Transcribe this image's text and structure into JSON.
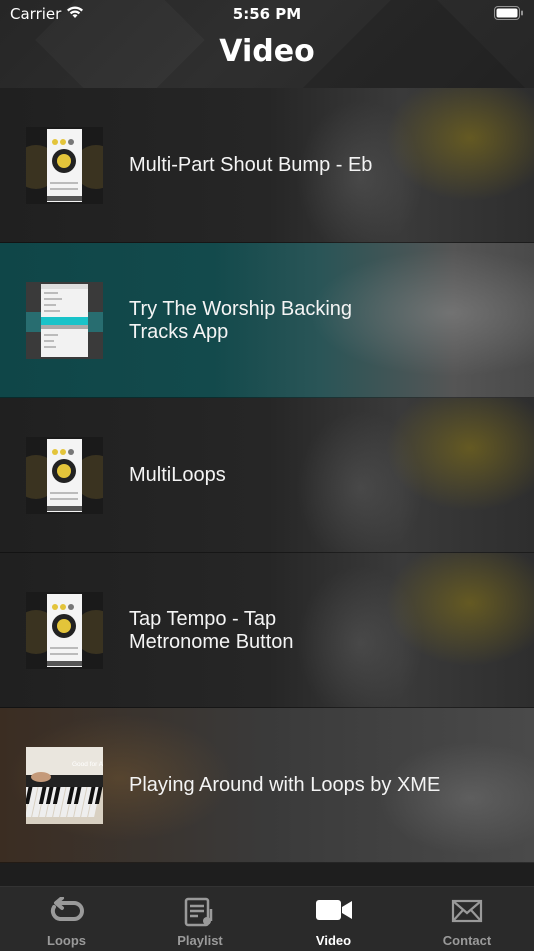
{
  "status": {
    "carrier": "Carrier",
    "time": "5:56 PM"
  },
  "header": {
    "title": "Video"
  },
  "videos": [
    {
      "title_lines": [
        "Multi-Part Shout Bump - Eb"
      ],
      "thumb": "app-screenshot",
      "bg": "dark"
    },
    {
      "title_lines": [
        "Try The Worship Backing",
        "Tracks App"
      ],
      "thumb": "app-list",
      "bg": "teal"
    },
    {
      "title_lines": [
        "MultiLoops"
      ],
      "thumb": "app-screenshot",
      "bg": "dark"
    },
    {
      "title_lines": [
        "Tap Tempo - Tap",
        "Metronome Button"
      ],
      "thumb": "app-screenshot",
      "bg": "dark"
    },
    {
      "title_lines": [
        "Playing Around with Loops by XME"
      ],
      "thumb": "keyboard-photo",
      "thumb_caption": "Good for An",
      "bg": "brown"
    }
  ],
  "tabs": [
    {
      "label": "Loops",
      "icon": "loop-icon",
      "active": false
    },
    {
      "label": "Playlist",
      "icon": "playlist-icon",
      "active": false
    },
    {
      "label": "Video",
      "icon": "video-camera-icon",
      "active": true
    },
    {
      "label": "Contact",
      "icon": "envelope-icon",
      "active": false
    }
  ],
  "colors": {
    "accent_teal": "#0f4648",
    "active_tab": "#ffffff",
    "inactive_tab": "#9a9a9a"
  }
}
